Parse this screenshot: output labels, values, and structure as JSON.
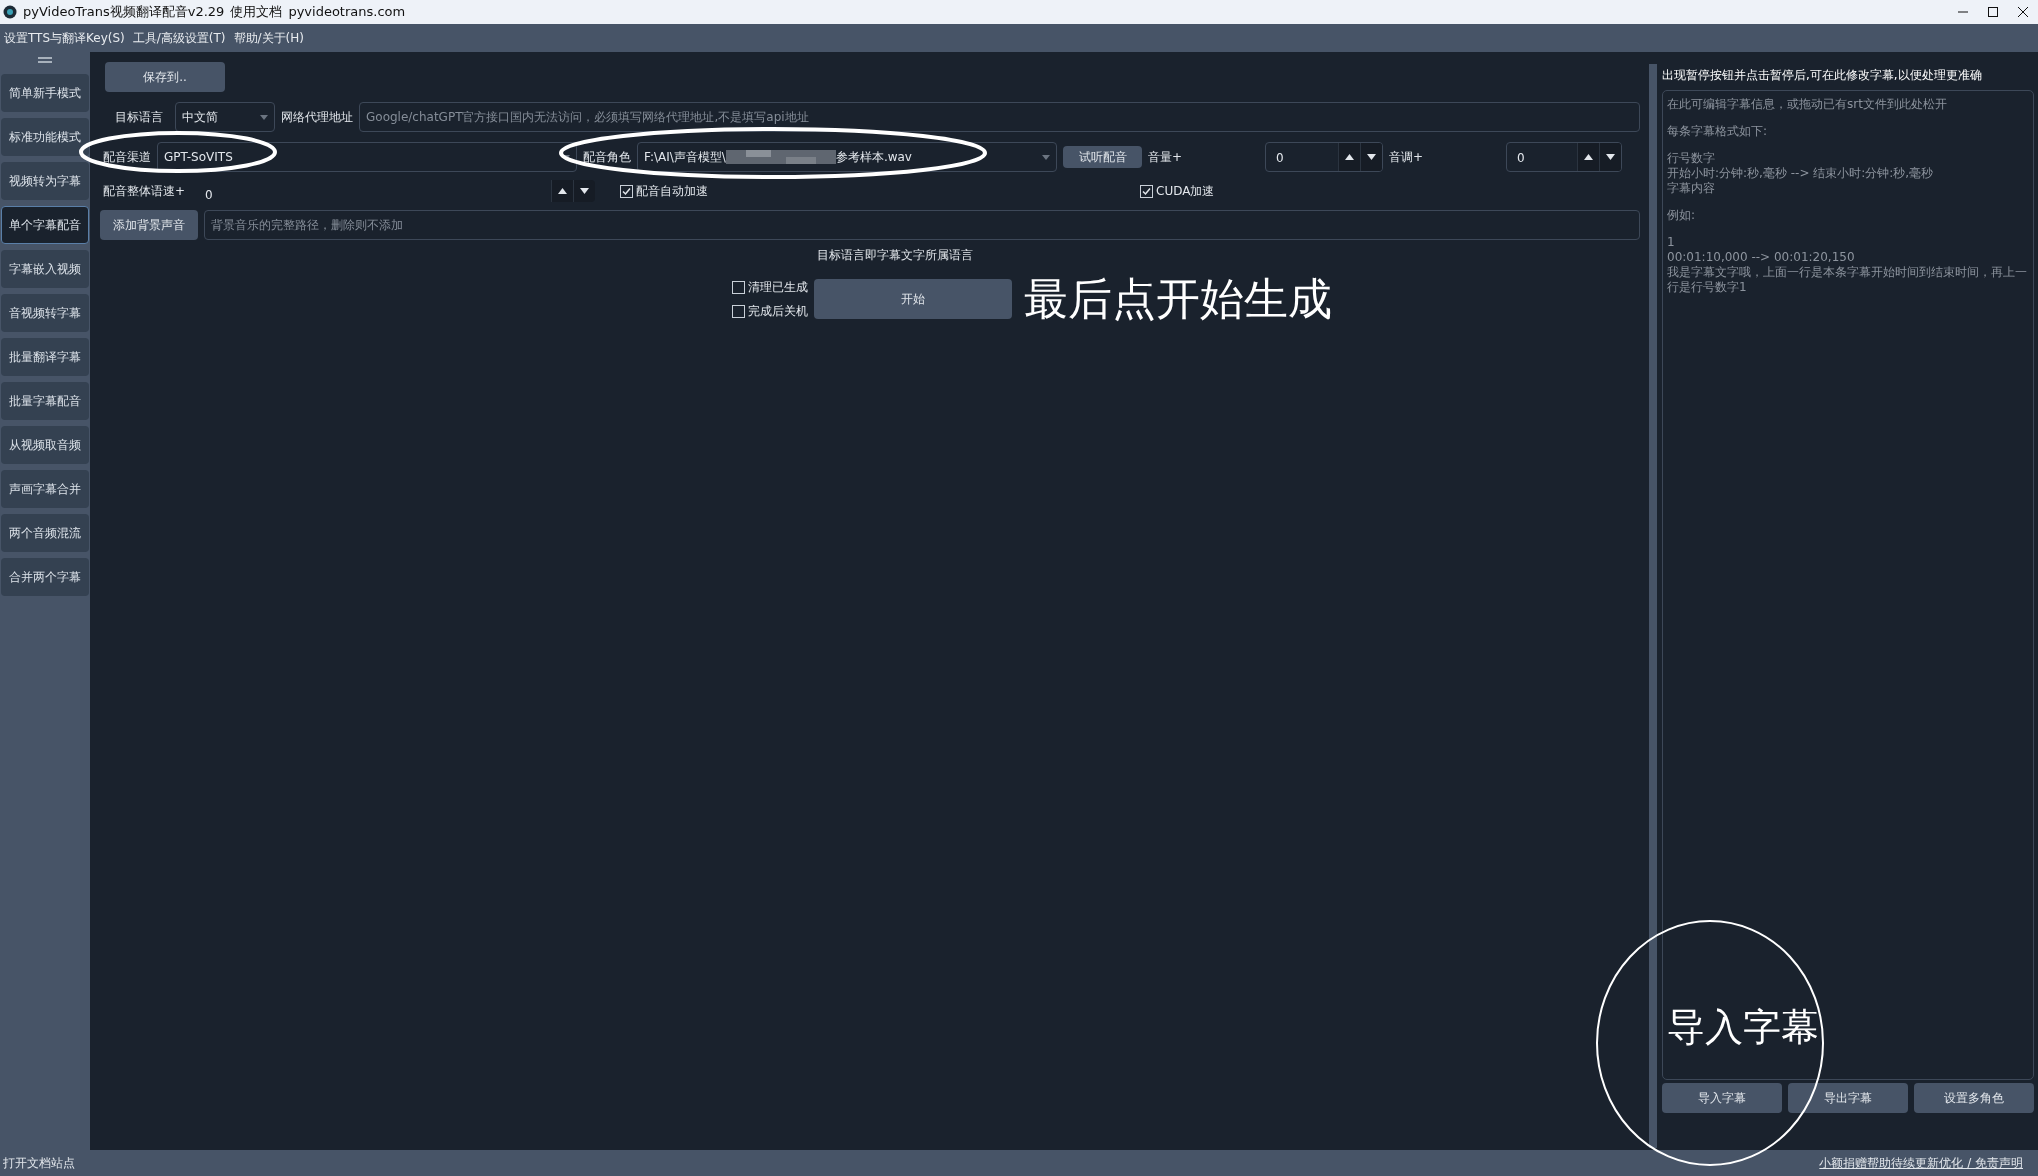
{
  "window": {
    "title": "pyVideoTrans视频翻译配音v2.29",
    "doc_link": "使用文档",
    "site": "pyvideotrans.com"
  },
  "menu": [
    {
      "label": "设置TTS与翻译Key(S)"
    },
    {
      "label": "工具/高级设置(T)"
    },
    {
      "label": "帮助/关于(H)"
    }
  ],
  "sidebar": [
    {
      "label": "简单新手模式",
      "selected": false
    },
    {
      "label": "标准功能模式",
      "selected": false
    },
    {
      "label": "视频转为字幕",
      "selected": false
    },
    {
      "label": "单个字幕配音",
      "selected": true
    },
    {
      "label": "字幕嵌入视频",
      "selected": false
    },
    {
      "label": "音视频转字幕",
      "selected": false
    },
    {
      "label": "批量翻译字幕",
      "selected": false
    },
    {
      "label": "批量字幕配音",
      "selected": false
    },
    {
      "label": "从视频取音频",
      "selected": false
    },
    {
      "label": "声画字幕合并",
      "selected": false
    },
    {
      "label": "两个音频混流",
      "selected": false
    },
    {
      "label": "合并两个字幕",
      "selected": false
    }
  ],
  "main": {
    "save_button": "保存到..",
    "target_language": {
      "label": "目标语言",
      "value": "中文简"
    },
    "proxy": {
      "label": "网络代理地址",
      "placeholder": "Google/chatGPT官方接口国内无法访问，必须填写网络代理地址,不是填写api地址"
    },
    "voice_channel": {
      "label": "配音渠道",
      "value": "GPT-SoVITS",
      "circled": true
    },
    "voice_role": {
      "label": "配音角色",
      "value_start": "F:\\AI\\声音模型\\",
      "redacted": true,
      "value_end": "参考样本.wav",
      "circled": true
    },
    "preview_button": "试听配音",
    "volume": {
      "label": "音量+",
      "value": "0"
    },
    "pitch": {
      "label": "音调+",
      "value": "0"
    },
    "speed": {
      "label": "配音整体语速+",
      "value": "0"
    },
    "auto_speed": {
      "label": "配音自动加速",
      "checked": true
    },
    "cuda": {
      "label": "CUDA加速",
      "checked": true
    },
    "background_button": "添加背景声音",
    "background_path": {
      "placeholder": "背景音乐的完整路径，删除则不添加"
    },
    "hint": "目标语言即字幕文字所属语言",
    "clean_generated": {
      "label": "清理已生成",
      "checked": false
    },
    "shutdown_after": {
      "label": "完成后关机",
      "checked": false
    },
    "start_button": "开始",
    "note": "最后点开始生成"
  },
  "subtitle_panel": {
    "title": "出现暂停按钮并点击暂停后,可在此修改字幕,以便处理更准确",
    "placeholder_paragraphs": [
      [
        " 在此可编辑字幕信息，或拖动已有srt文件到此处松开"
      ],
      [
        "每条字幕格式如下:"
      ],
      [
        "行号数字",
        "开始小时:分钟:秒,毫秒 --> 结束小时:分钟:秒,毫秒",
        "字幕内容"
      ],
      [
        "例如:"
      ],
      [
        "1",
        "00:01:10,000 --> 00:01:20,150",
        "我是字幕文字哦，上面一行是本条字幕开始时间到结束时间，再上一行是行号数字1"
      ]
    ],
    "buttons": [
      {
        "label": "导入字幕",
        "circled": true
      },
      {
        "label": "导出字幕",
        "circled": false
      },
      {
        "label": "设置多角色",
        "circled": false
      }
    ],
    "note": "导入字幕"
  },
  "status_bar": {
    "left": "打开文档站点",
    "right": "小额捐赠帮助待续更新优化 / 免责声明"
  }
}
